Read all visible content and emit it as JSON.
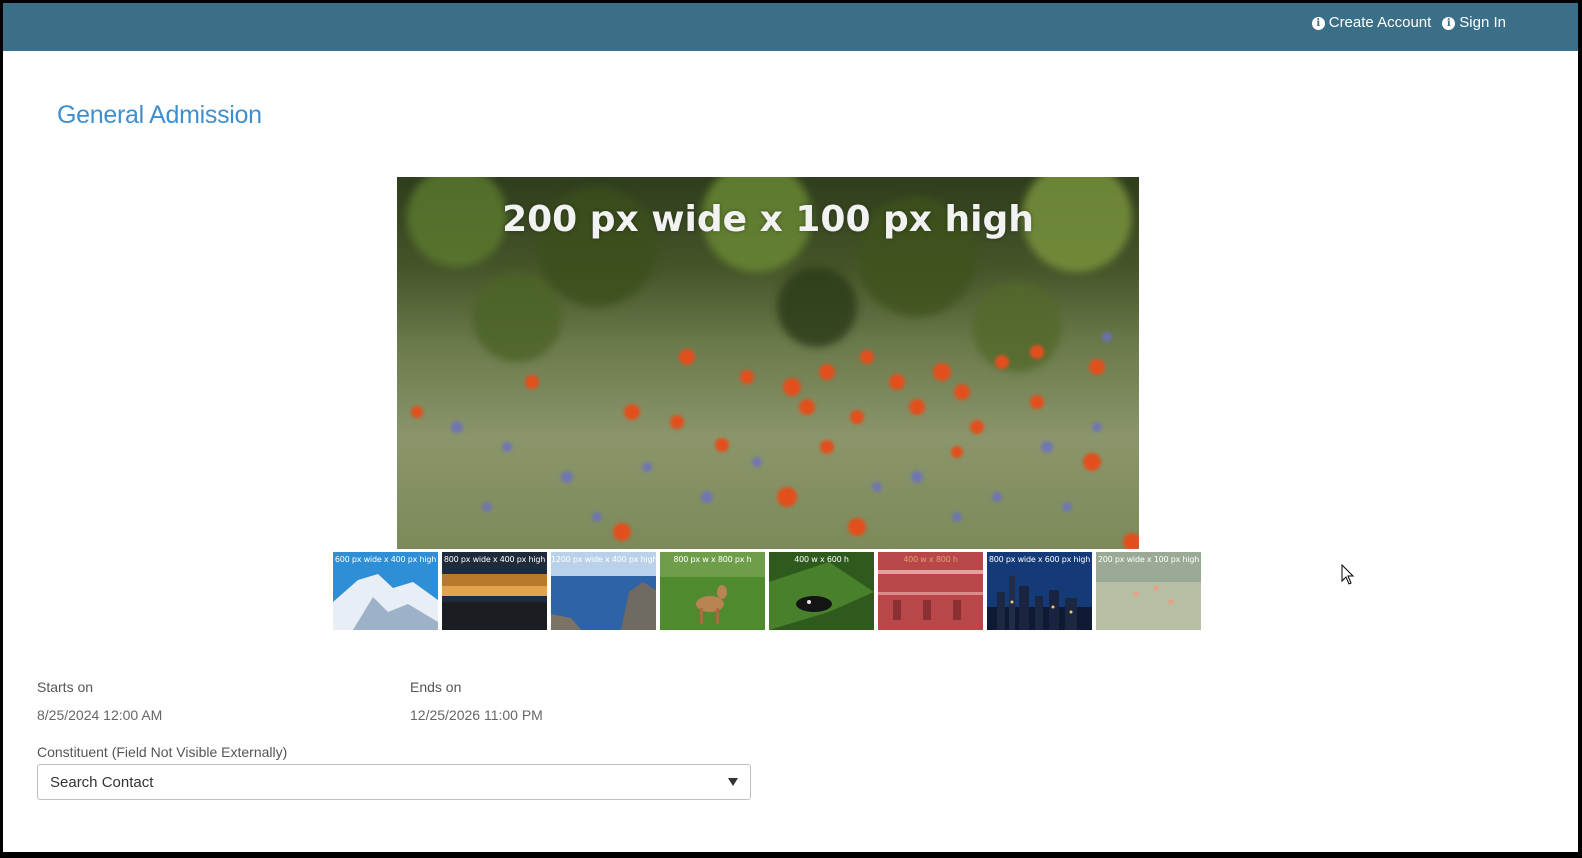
{
  "nav": {
    "create_account": "Create Account",
    "sign_in": "Sign In",
    "icon": "info-circle-icon"
  },
  "page": {
    "title": "General Admission"
  },
  "hero": {
    "caption": "200 px wide x 100 px high"
  },
  "thumbnails": [
    {
      "caption": "600 px wide x 400 px high"
    },
    {
      "caption": "800 px wide x 400 px high"
    },
    {
      "caption": "1200 px wide x 400 px high"
    },
    {
      "caption": "800 px w x 800 px h"
    },
    {
      "caption": "400 w x 600 h"
    },
    {
      "caption": "400 w x 800 h"
    },
    {
      "caption": "800 px wide x 600 px high"
    },
    {
      "caption": "200 px wide x 100 px high"
    }
  ],
  "event": {
    "starts_label": "Starts on",
    "starts_value": "8/25/2024 12:00 AM",
    "ends_label": "Ends on",
    "ends_value": "12/25/2026 11:00 PM"
  },
  "constituent": {
    "label": "Constituent (Field Not Visible Externally)",
    "value": "Search Contact"
  },
  "colors": {
    "topbar": "#3b6e87",
    "title": "#3e8fcf"
  }
}
